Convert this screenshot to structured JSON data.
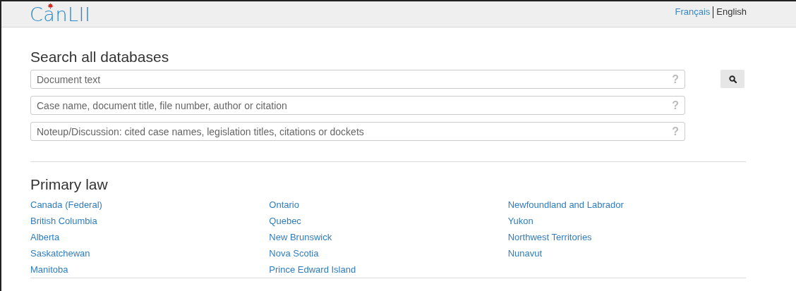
{
  "header": {
    "logo": "CanLII",
    "languages": [
      {
        "label": "Français",
        "selected": false
      },
      {
        "label": "English",
        "selected": true
      }
    ]
  },
  "search": {
    "title": "Search all databases",
    "fields": [
      {
        "placeholder": "Document text",
        "help": "?"
      },
      {
        "placeholder": "Case name, document title, file number, author or citation",
        "help": "?"
      },
      {
        "placeholder": "Noteup/Discussion: cited case names, legislation titles, citations or dockets",
        "help": "?"
      }
    ]
  },
  "primary_law": {
    "title": "Primary law",
    "columns": [
      [
        "Canada (Federal)",
        "British Columbia",
        "Alberta",
        "Saskatchewan",
        "Manitoba"
      ],
      [
        "Ontario",
        "Quebec",
        "New Brunswick",
        "Nova Scotia",
        "Prince Edward Island"
      ],
      [
        "Newfoundland and Labrador",
        "Yukon",
        "Northwest Territories",
        "Nunavut"
      ]
    ]
  }
}
